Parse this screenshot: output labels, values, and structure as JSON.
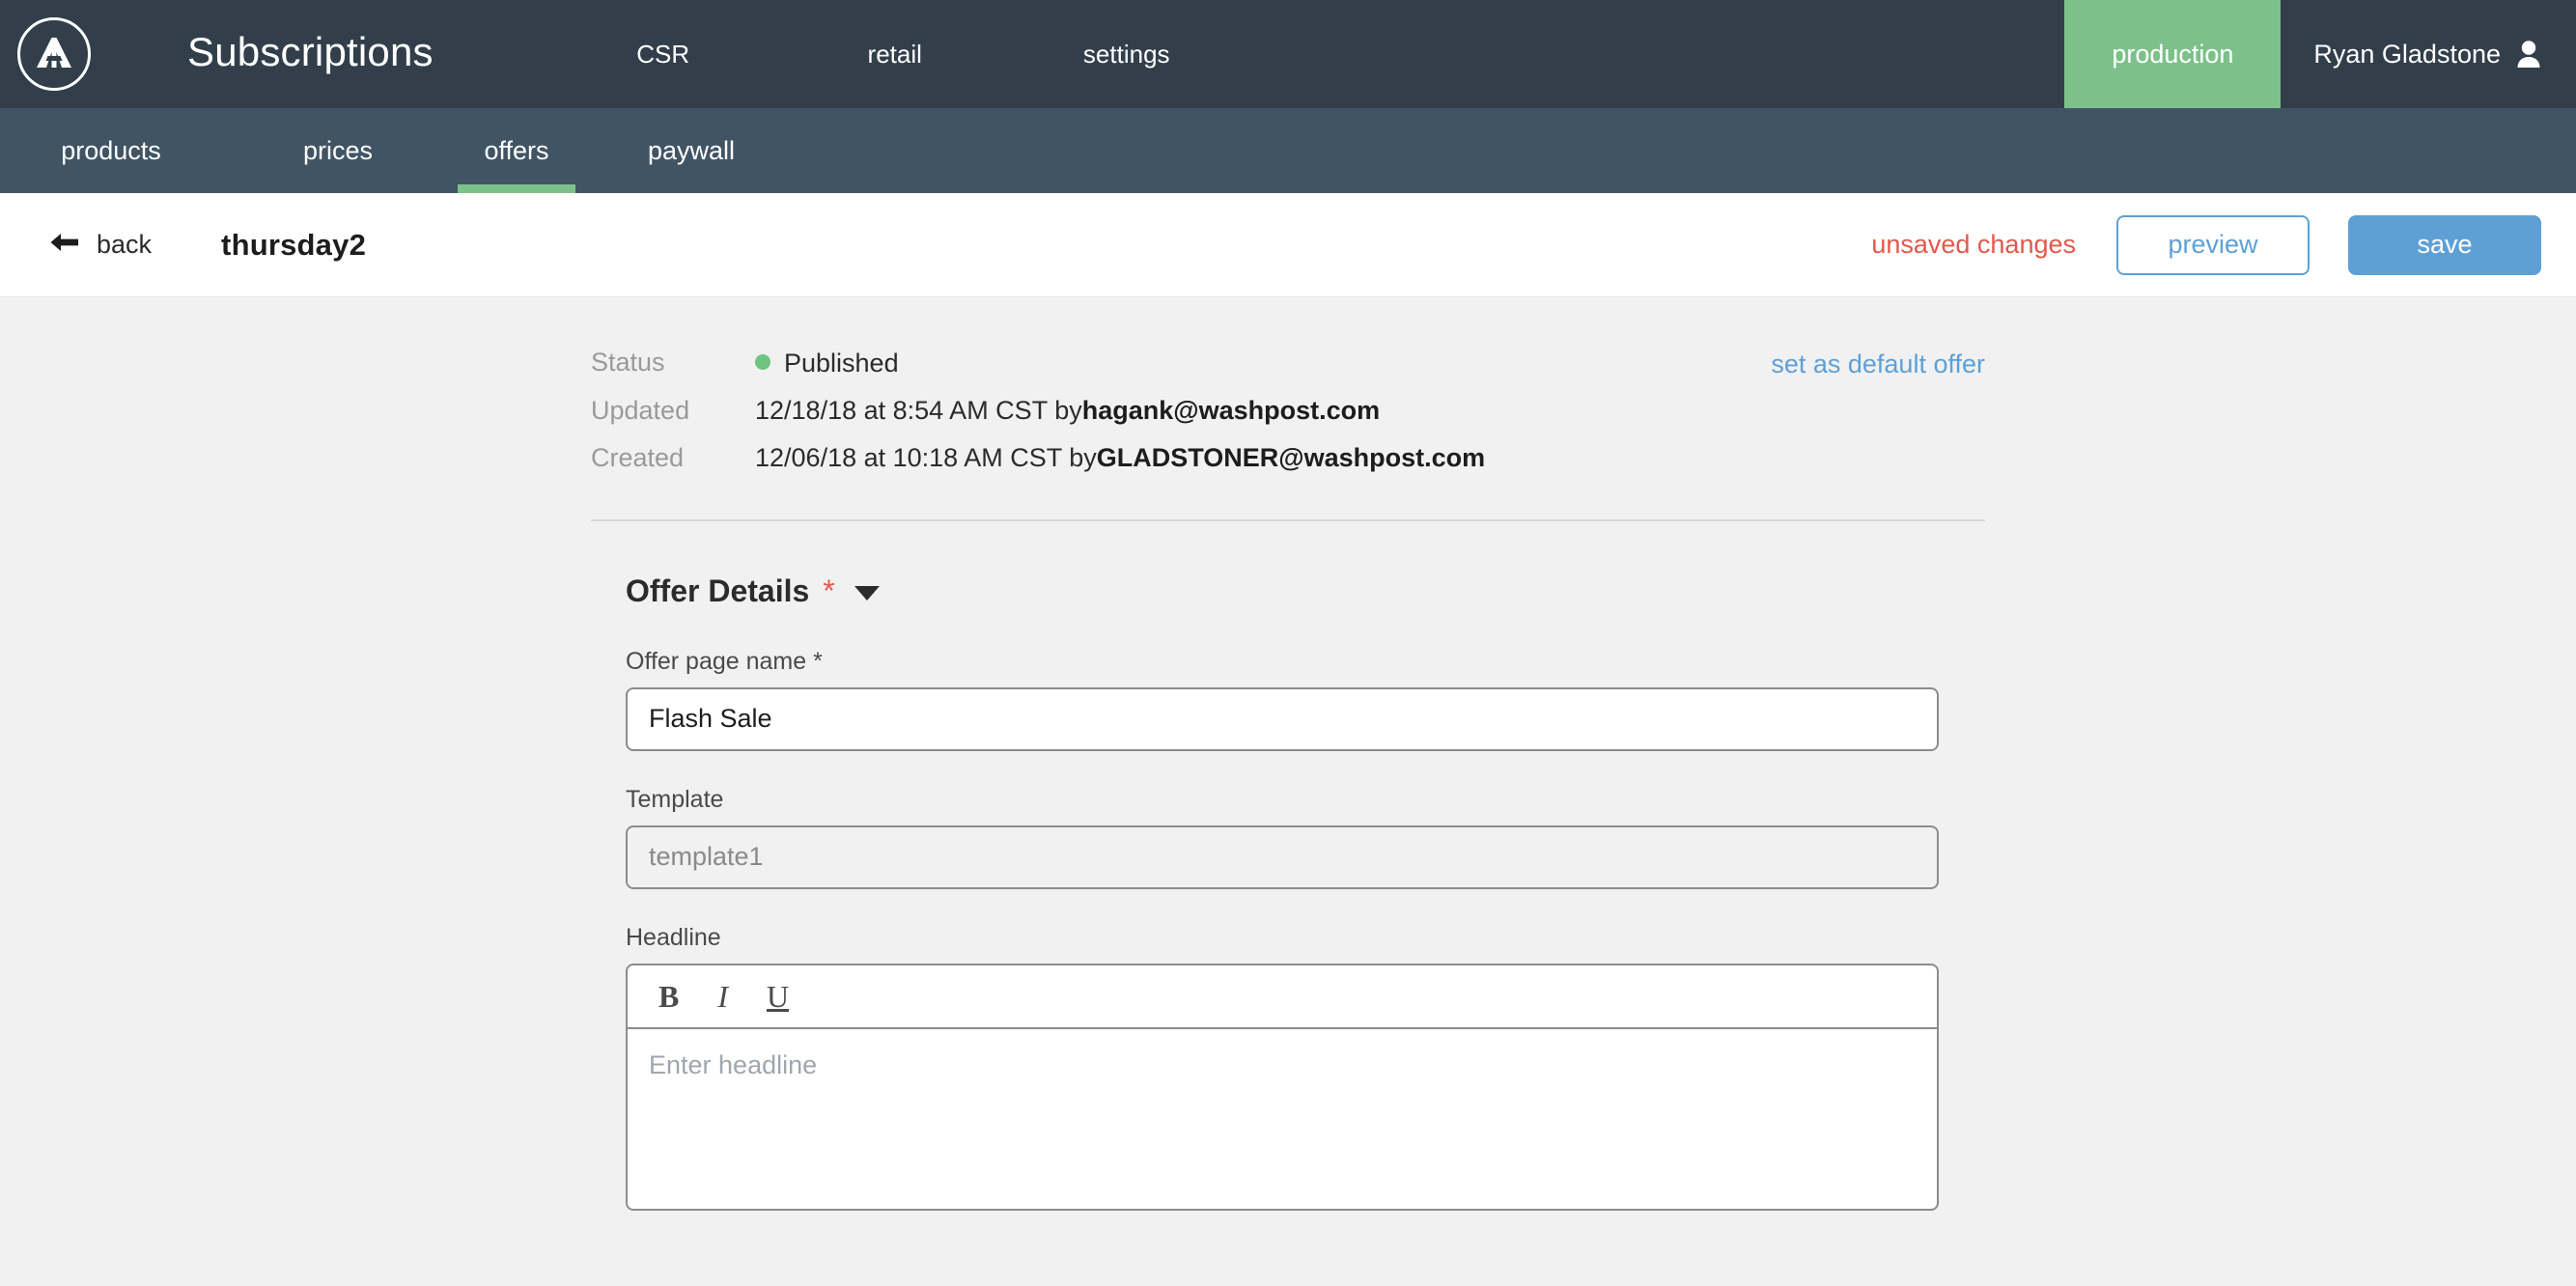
{
  "topnav": {
    "logo_icon": "arc-logo-icon",
    "brand": "Subscriptions",
    "links": [
      {
        "label": "CSR",
        "name": "topnav-link-csr"
      },
      {
        "label": "retail",
        "name": "topnav-link-retail"
      },
      {
        "label": "settings",
        "name": "topnav-link-settings"
      }
    ],
    "environment": "production",
    "user_name": "Ryan Gladstone",
    "user_icon": "user-avatar-icon",
    "bg_color": "#323f4b",
    "env_color": "#7cc18a"
  },
  "subnav": {
    "items": [
      {
        "label": "products",
        "active": false
      },
      {
        "label": "prices",
        "active": false
      },
      {
        "label": "offers",
        "active": true
      },
      {
        "label": "paywall",
        "active": false
      }
    ],
    "bg_color": "#415464",
    "active_underline_color": "#7cc18a"
  },
  "page_header": {
    "back_icon": "arrow-left-icon",
    "back_label": "back",
    "title": "thursday2",
    "unsaved_label": "unsaved changes",
    "unsaved_color": "#e2584d",
    "preview_label": "preview",
    "save_label": "save",
    "primary_color": "#5ea0d6"
  },
  "meta": {
    "status_label": "Status",
    "status_value": "Published",
    "status_dot_color": "#6ec37f",
    "updated_label": "Updated",
    "updated_value": "12/18/18 at 8:54 AM CST by ",
    "updated_user": "hagank@washpost.com",
    "created_label": "Created",
    "created_value": "12/06/18 at 10:18 AM CST by ",
    "created_user": "GLADSTONER@washpost.com",
    "set_default_label": "set as default offer"
  },
  "offer_details": {
    "section_title": "Offer Details",
    "required_marker": "*",
    "caret_icon": "chevron-down-icon",
    "fields": {
      "offer_page_name": {
        "label": "Offer page name *",
        "value": "Flash Sale",
        "placeholder": "Offer page name"
      },
      "template": {
        "label": "Template",
        "value": "template1",
        "placeholder": "template1"
      },
      "headline": {
        "label": "Headline",
        "value": "",
        "placeholder": "Enter headline",
        "toolbar": {
          "bold": "B",
          "italic": "I",
          "underline": "U"
        }
      }
    }
  }
}
